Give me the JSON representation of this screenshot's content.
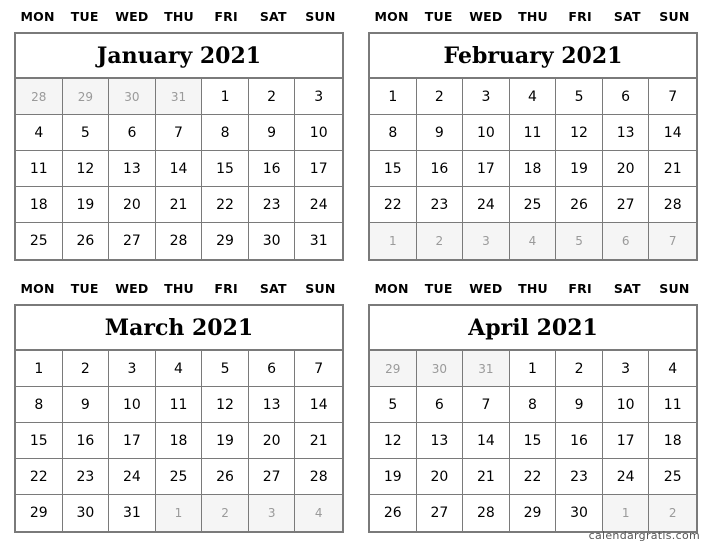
{
  "weekdays": [
    "MON",
    "TUE",
    "WED",
    "THU",
    "FRI",
    "SAT",
    "SUN"
  ],
  "calendars": [
    {
      "title": "January 2021",
      "days": [
        {
          "d": "28",
          "other": true
        },
        {
          "d": "29",
          "other": true
        },
        {
          "d": "30",
          "other": true
        },
        {
          "d": "31",
          "other": true
        },
        {
          "d": "1"
        },
        {
          "d": "2"
        },
        {
          "d": "3"
        },
        {
          "d": "4"
        },
        {
          "d": "5"
        },
        {
          "d": "6"
        },
        {
          "d": "7"
        },
        {
          "d": "8"
        },
        {
          "d": "9"
        },
        {
          "d": "10"
        },
        {
          "d": "11"
        },
        {
          "d": "12"
        },
        {
          "d": "13"
        },
        {
          "d": "14"
        },
        {
          "d": "15"
        },
        {
          "d": "16"
        },
        {
          "d": "17"
        },
        {
          "d": "18"
        },
        {
          "d": "19"
        },
        {
          "d": "20"
        },
        {
          "d": "21"
        },
        {
          "d": "22"
        },
        {
          "d": "23"
        },
        {
          "d": "24"
        },
        {
          "d": "25"
        },
        {
          "d": "26"
        },
        {
          "d": "27"
        },
        {
          "d": "28"
        },
        {
          "d": "29"
        },
        {
          "d": "30"
        },
        {
          "d": "31"
        }
      ]
    },
    {
      "title": "February 2021",
      "days": [
        {
          "d": "1"
        },
        {
          "d": "2"
        },
        {
          "d": "3"
        },
        {
          "d": "4"
        },
        {
          "d": "5"
        },
        {
          "d": "6"
        },
        {
          "d": "7"
        },
        {
          "d": "8"
        },
        {
          "d": "9"
        },
        {
          "d": "10"
        },
        {
          "d": "11"
        },
        {
          "d": "12"
        },
        {
          "d": "13"
        },
        {
          "d": "14"
        },
        {
          "d": "15"
        },
        {
          "d": "16"
        },
        {
          "d": "17"
        },
        {
          "d": "18"
        },
        {
          "d": "19"
        },
        {
          "d": "20"
        },
        {
          "d": "21"
        },
        {
          "d": "22"
        },
        {
          "d": "23"
        },
        {
          "d": "24"
        },
        {
          "d": "25"
        },
        {
          "d": "26"
        },
        {
          "d": "27"
        },
        {
          "d": "28"
        },
        {
          "d": "1",
          "other": true
        },
        {
          "d": "2",
          "other": true
        },
        {
          "d": "3",
          "other": true
        },
        {
          "d": "4",
          "other": true
        },
        {
          "d": "5",
          "other": true
        },
        {
          "d": "6",
          "other": true
        },
        {
          "d": "7",
          "other": true
        }
      ]
    },
    {
      "title": "March 2021",
      "days": [
        {
          "d": "1"
        },
        {
          "d": "2"
        },
        {
          "d": "3"
        },
        {
          "d": "4"
        },
        {
          "d": "5"
        },
        {
          "d": "6"
        },
        {
          "d": "7"
        },
        {
          "d": "8"
        },
        {
          "d": "9"
        },
        {
          "d": "10"
        },
        {
          "d": "11"
        },
        {
          "d": "12"
        },
        {
          "d": "13"
        },
        {
          "d": "14"
        },
        {
          "d": "15"
        },
        {
          "d": "16"
        },
        {
          "d": "17"
        },
        {
          "d": "18"
        },
        {
          "d": "19"
        },
        {
          "d": "20"
        },
        {
          "d": "21"
        },
        {
          "d": "22"
        },
        {
          "d": "23"
        },
        {
          "d": "24"
        },
        {
          "d": "25"
        },
        {
          "d": "26"
        },
        {
          "d": "27"
        },
        {
          "d": "28"
        },
        {
          "d": "29"
        },
        {
          "d": "30"
        },
        {
          "d": "31"
        },
        {
          "d": "1",
          "other": true
        },
        {
          "d": "2",
          "other": true
        },
        {
          "d": "3",
          "other": true
        },
        {
          "d": "4",
          "other": true
        }
      ]
    },
    {
      "title": "April 2021",
      "days": [
        {
          "d": "29",
          "other": true
        },
        {
          "d": "30",
          "other": true
        },
        {
          "d": "31",
          "other": true
        },
        {
          "d": "1"
        },
        {
          "d": "2"
        },
        {
          "d": "3"
        },
        {
          "d": "4"
        },
        {
          "d": "5"
        },
        {
          "d": "6"
        },
        {
          "d": "7"
        },
        {
          "d": "8"
        },
        {
          "d": "9"
        },
        {
          "d": "10"
        },
        {
          "d": "11"
        },
        {
          "d": "12"
        },
        {
          "d": "13"
        },
        {
          "d": "14"
        },
        {
          "d": "15"
        },
        {
          "d": "16"
        },
        {
          "d": "17"
        },
        {
          "d": "18"
        },
        {
          "d": "19"
        },
        {
          "d": "20"
        },
        {
          "d": "21"
        },
        {
          "d": "22"
        },
        {
          "d": "23"
        },
        {
          "d": "24"
        },
        {
          "d": "25"
        },
        {
          "d": "26"
        },
        {
          "d": "27"
        },
        {
          "d": "28"
        },
        {
          "d": "29"
        },
        {
          "d": "30"
        },
        {
          "d": "1",
          "other": true
        },
        {
          "d": "2",
          "other": true
        }
      ]
    }
  ],
  "watermark": "calendargratis.com"
}
